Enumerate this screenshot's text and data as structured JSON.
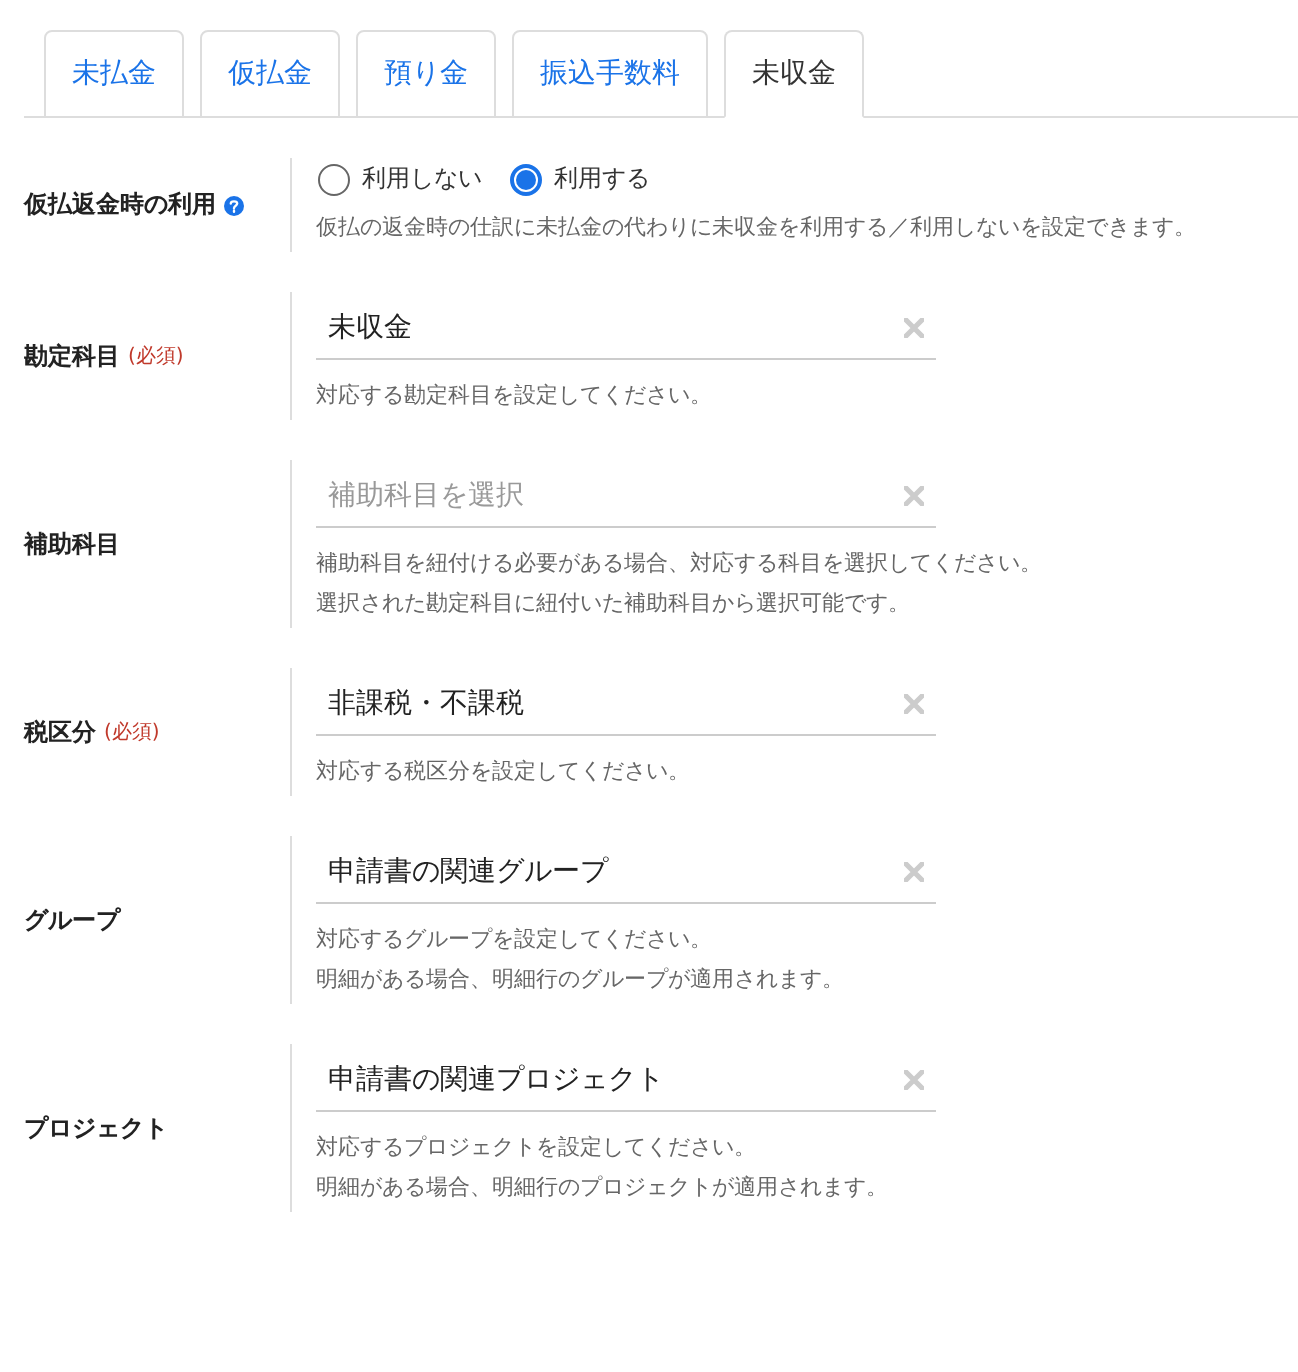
{
  "tabs": [
    {
      "label": "未払金",
      "selected": false
    },
    {
      "label": "仮払金",
      "selected": false
    },
    {
      "label": "預り金",
      "selected": false
    },
    {
      "label": "振込手数料",
      "selected": false
    },
    {
      "label": "未収金",
      "selected": true
    }
  ],
  "fields": [
    {
      "kind": "radio",
      "label": "仮払返金時の利用",
      "help": true,
      "options": [
        {
          "label": "利用しない",
          "selected": false
        },
        {
          "label": "利用する",
          "selected": true
        }
      ],
      "hints": [
        "仮払の返金時の仕訳に未払金の代わりに未収金を利用する／利用しないを設定できます。"
      ]
    },
    {
      "kind": "select",
      "label": "勘定科目",
      "required": "(必須)",
      "value": "未収金",
      "hints": [
        "対応する勘定科目を設定してください。"
      ]
    },
    {
      "kind": "select",
      "label": "補助科目",
      "placeholder": "補助科目を選択",
      "hints": [
        "補助科目を紐付ける必要がある場合、対応する科目を選択してください。",
        "選択された勘定科目に紐付いた補助科目から選択可能です。"
      ]
    },
    {
      "kind": "select",
      "label": "税区分",
      "required": "(必須)",
      "value": "非課税・不課税",
      "hints": [
        "対応する税区分を設定してください。"
      ]
    },
    {
      "kind": "select",
      "label": "グループ",
      "value": "申請書の関連グループ",
      "hints": [
        "対応するグループを設定してください。",
        "明細がある場合、明細行のグループが適用されます。"
      ]
    },
    {
      "kind": "select",
      "label": "プロジェクト",
      "value": "申請書の関連プロジェクト",
      "hints": [
        "対応するプロジェクトを設定してください。",
        "明細がある場合、明細行のプロジェクトが適用されます。"
      ]
    }
  ]
}
